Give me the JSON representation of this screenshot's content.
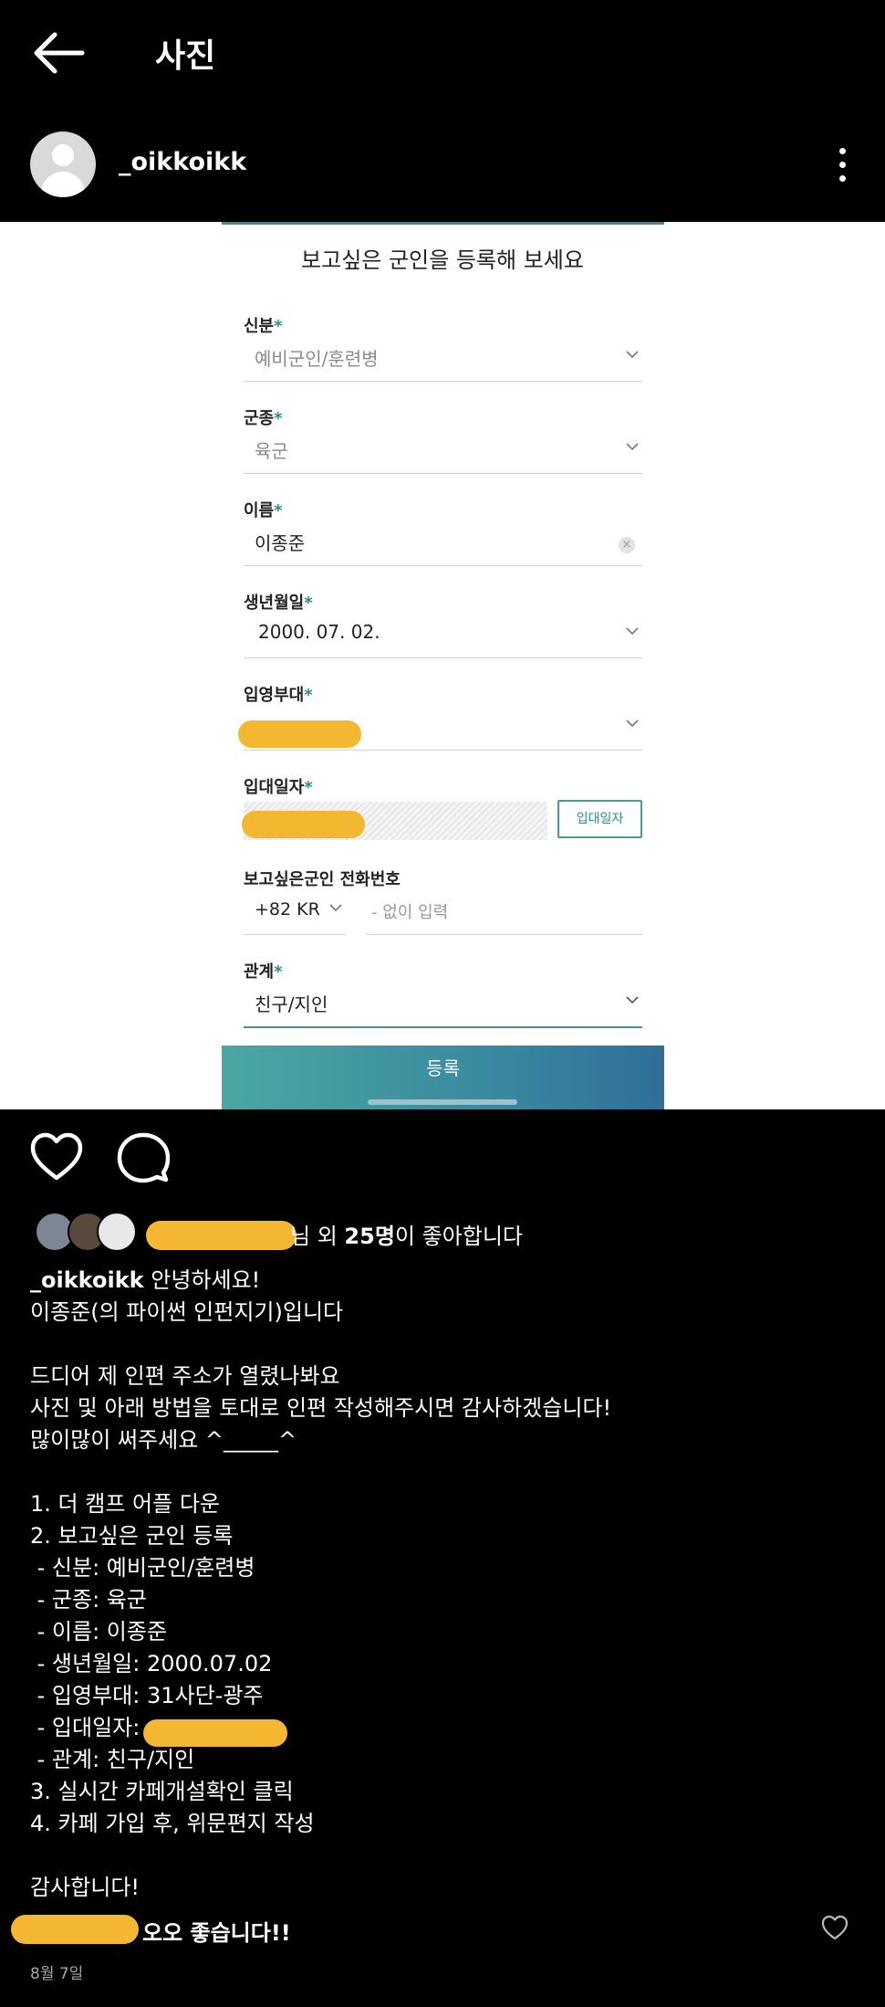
{
  "header": {
    "title": "사진"
  },
  "post": {
    "username": "_oikkoikk"
  },
  "form": {
    "title": "보고싶은 군인을 등록해 보세요",
    "fields": [
      {
        "label": "신분",
        "value": "예비군인/훈련병"
      },
      {
        "label": "군종",
        "value": "육군"
      },
      {
        "label": "이름",
        "value": "이종준"
      },
      {
        "label": "생년월일",
        "value": "2000. 07. 02."
      },
      {
        "label": "입영부대",
        "value": ""
      },
      {
        "label": "입대일자",
        "button": "입대일자"
      }
    ],
    "phone": {
      "label": "보고싶은군인 전화번호",
      "country_code": "+82 KR",
      "placeholder": "- 없이 입력"
    },
    "relation": {
      "label": "관계",
      "value": "친구/지인"
    },
    "submit": "등록",
    "required_mark": "*"
  },
  "likes": {
    "text_prefix": "님 외 ",
    "count": "25명",
    "text_suffix": "이 좋아합니다"
  },
  "caption": {
    "username": "_oikkoikk",
    "text": " 안녕하세요!\n이종준(의 파이썬 인펀지기)입니다\n\n드디어 제 인편 주소가 열렸나봐요\n사진 및 아래 방법을 토대로 인편 작성해주시면 감사하겠습니다!\n많이많이 써주세요 ^_____^\n\n1. 더 캠프 어플 다운\n2. 보고싶은 군인 등록\n - 신분: 예비군인/훈련병\n - 군종: 육군\n - 이름: 이종준\n - 생년월일: 2000.07.02\n - 입영부대: 31사단-광주\n - 입대일자:\n - 관계: 친구/지인\n3. 실시간 카페개설확인 클릭\n4. 카페 가입 후, 위문편지 작성\n\n감사합니다!"
  },
  "comment": {
    "text": "오오 좋습니다!!"
  },
  "date": "8월 7일",
  "colors": {
    "accent": "#2e8c86",
    "redaction": "#f3b731",
    "background": "#000000"
  }
}
